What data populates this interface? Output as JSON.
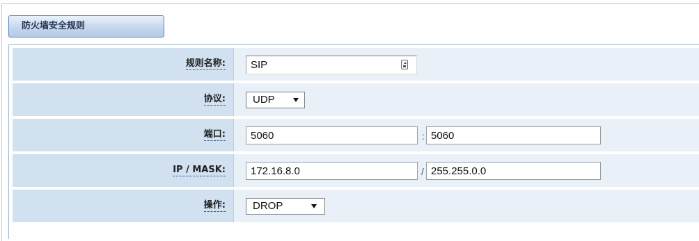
{
  "section": {
    "title": "防火墙安全规则"
  },
  "rules": {
    "name": {
      "label": "规则名称:",
      "value": "SIP"
    },
    "protocol": {
      "label": "协议:",
      "value": "UDP"
    },
    "port": {
      "label": "端口:",
      "start": "5060",
      "separator": ":",
      "end": "5060"
    },
    "ip_mask": {
      "label": "IP / MASK:",
      "ip": "172.16.8.0",
      "separator": "/",
      "mask": "255.255.0.0"
    },
    "action": {
      "label": "操作:",
      "value": "DROP"
    }
  },
  "colors": {
    "label_bg": "#d2e1f0",
    "value_bg": "#eaf0f8",
    "tab_border": "#5f86b3"
  },
  "icons": {
    "name_field_icon": "key-icon",
    "dropdown_icon": "chevron-down-icon"
  }
}
